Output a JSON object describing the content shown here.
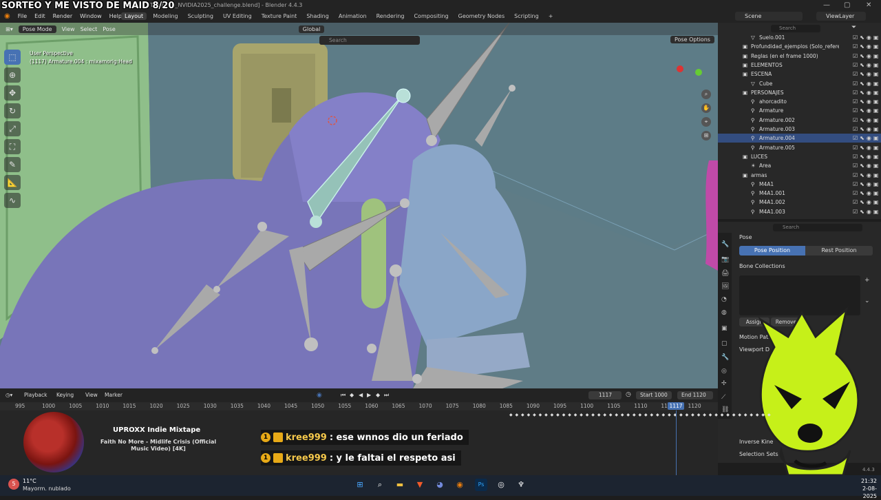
{
  "overlay": {
    "stream_title": "SORTEO Y ME VISTO DE MAID 8/20"
  },
  "window": {
    "filepath": "Template_NVIDIA2025_challenge.blend] - Blender 4.4.3"
  },
  "menu": [
    "File",
    "Edit",
    "Render",
    "Window",
    "Help"
  ],
  "workspaces": [
    "Layout",
    "Modeling",
    "Sculpting",
    "UV Editing",
    "Texture Paint",
    "Shading",
    "Animation",
    "Rendering",
    "Compositing",
    "Geometry Nodes",
    "Scripting"
  ],
  "active_workspace": "Layout",
  "topright": {
    "scene": "Scene",
    "view_layer": "ViewLayer"
  },
  "viewport_header": {
    "mode": "Pose Mode",
    "view": "View",
    "select": "Select",
    "pose": "Pose",
    "orientation": "Global",
    "search_placeholder": "Search",
    "pose_options": "Pose Options"
  },
  "viewport_info": {
    "perspective": "User Perspective",
    "object": "(1117) Armature.004 : mixamorig:Head"
  },
  "outliner": {
    "search_placeholder": "Search",
    "rows": [
      {
        "name": "Suelo.001",
        "indent": 2,
        "icon": "mesh"
      },
      {
        "name": "Profundidad_ejemplos (Solo_referencia)",
        "indent": 1,
        "icon": "collection"
      },
      {
        "name": "Reglas (en el frame 1000)",
        "indent": 1,
        "icon": "collection"
      },
      {
        "name": "ELEMENTOS",
        "indent": 1,
        "icon": "collection"
      },
      {
        "name": "ESCENA",
        "indent": 1,
        "icon": "collection"
      },
      {
        "name": "Cube",
        "indent": 2,
        "icon": "mesh"
      },
      {
        "name": "PERSONAJES",
        "indent": 1,
        "icon": "collection"
      },
      {
        "name": "ahorcadito",
        "indent": 2,
        "icon": "armature"
      },
      {
        "name": "Armature",
        "indent": 2,
        "icon": "armature"
      },
      {
        "name": "Armature.002",
        "indent": 2,
        "icon": "armature"
      },
      {
        "name": "Armature.003",
        "indent": 2,
        "icon": "armature"
      },
      {
        "name": "Armature.004",
        "indent": 2,
        "icon": "armature",
        "selected": true
      },
      {
        "name": "Armature.005",
        "indent": 2,
        "icon": "armature"
      },
      {
        "name": "LUCES",
        "indent": 1,
        "icon": "collection"
      },
      {
        "name": "Area",
        "indent": 2,
        "icon": "light"
      },
      {
        "name": "armas",
        "indent": 1,
        "icon": "collection"
      },
      {
        "name": "M4A1",
        "indent": 2,
        "icon": "armature"
      },
      {
        "name": "M4A1.001",
        "indent": 2,
        "icon": "armature"
      },
      {
        "name": "M4A1.002",
        "indent": 2,
        "icon": "armature"
      },
      {
        "name": "M4A1.003",
        "indent": 2,
        "icon": "armature"
      }
    ]
  },
  "properties": {
    "search_placeholder": "Search",
    "pose_section": "Pose",
    "pose_position": "Pose Position",
    "rest_position": "Rest Position",
    "bone_collections": "Bone Collections",
    "assign": "Assign",
    "remove": "Remove",
    "motion_paths": "Motion Paths",
    "viewport_display": "Viewport D",
    "inverse_kinematics": "Inverse Kine",
    "selection_sets": "Selection Sets"
  },
  "timeline": {
    "playback": "Playback",
    "keying": "Keying",
    "view": "View",
    "marker": "Marker",
    "current_frame": "1117",
    "start_label": "Start",
    "start": "1000",
    "end_label": "End",
    "end": "1120",
    "ticks": [
      "995",
      "1000",
      "1005",
      "1010",
      "1015",
      "1020",
      "1025",
      "1030",
      "1035",
      "1040",
      "1045",
      "1050",
      "1055",
      "1060",
      "1065",
      "1070",
      "1075",
      "1080",
      "1085",
      "1090",
      "1095",
      "1100",
      "1105",
      "1110",
      "1115",
      "1120"
    ],
    "playhead": "1117"
  },
  "music": {
    "title": "UPROXX Indie Mixtape",
    "track": "Faith No More - Midlife Crisis (Official Music Video) [4K]"
  },
  "chat": [
    {
      "badge": "1",
      "user": "kree999",
      "message": ": ese wnnos dio un feriado"
    },
    {
      "badge": "1",
      "user": "kree999",
      "message": ": y le faltai el respeto asi"
    }
  ],
  "taskbar": {
    "temperature": "11°C",
    "weather": "Mayorm. nublado",
    "time": "21:32",
    "date": "2-08-2025",
    "weather_badge": "5"
  },
  "version": "4.4.3",
  "colors": {
    "accent": "#4772b3",
    "viewport_bg": "#5f7c86",
    "mascot": "#c6f019",
    "chat_user": "#f5c84b"
  }
}
